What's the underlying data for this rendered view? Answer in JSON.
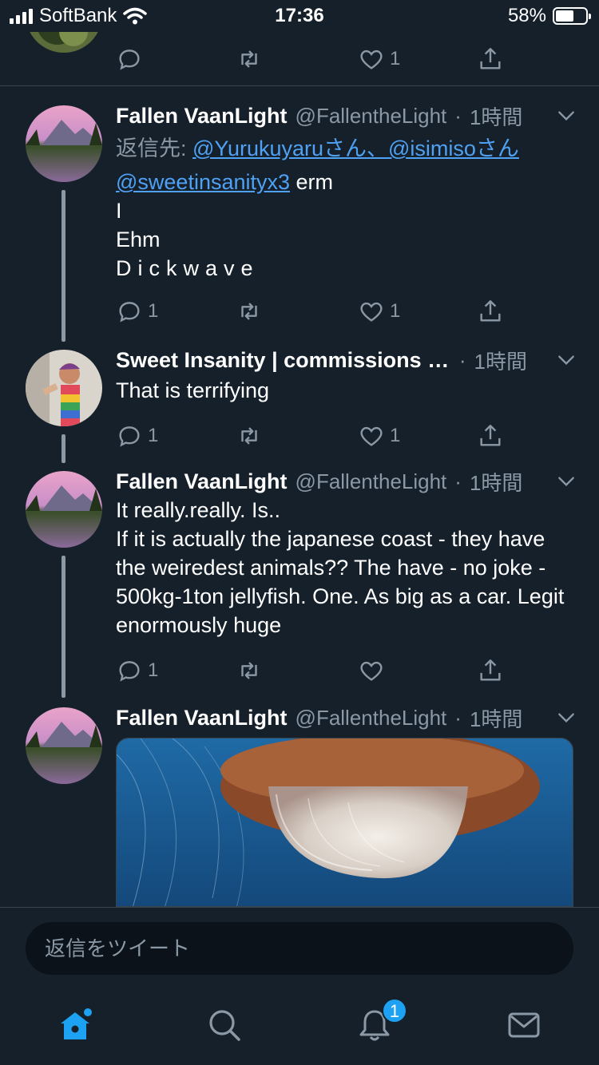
{
  "status_bar": {
    "carrier": "SoftBank",
    "time": "17:36",
    "battery": "58%"
  },
  "top_partial_tweet": {
    "like_count": "1"
  },
  "tweets": [
    {
      "name": "Fallen VaanLight",
      "handle": "@FallentheLight",
      "time_sep": "·",
      "time_ago": "1時間",
      "reply_prefix": "返信先: ",
      "reply_to_1": "@Yurukuyaruさん",
      "reply_sep": "、",
      "reply_to_2": "@isimisoさん",
      "mention": "@sweetinsanityx3",
      "text_1": " erm",
      "text_2": "I",
      "text_3": "Ehm",
      "text_4": "Dickwave",
      "reply_count": "1",
      "retweet_count": "",
      "like_count": "1"
    },
    {
      "name": "Sweet Insanity | commissions O...",
      "handle": "",
      "time_sep": "·",
      "time_ago": "1時間",
      "text": "That is terrifying",
      "reply_count": "1",
      "retweet_count": "",
      "like_count": "1"
    },
    {
      "name": "Fallen VaanLight",
      "handle": "@FallentheLight",
      "time_sep": "·",
      "time_ago": "1時間",
      "text": "It really.really. Is..\nIf it is actually the japanese coast - they have the weiredest animals?? The have - no joke - 500kg-1ton jellyfish. One. As big as a car. Legit enormously huge",
      "reply_count": "1",
      "retweet_count": "",
      "like_count": ""
    },
    {
      "name": "Fallen VaanLight",
      "handle": "@FallentheLight",
      "time_sep": "·",
      "time_ago": "1時間"
    }
  ],
  "reply_bar": {
    "placeholder": "返信をツイート"
  },
  "tab_bar": {
    "notifications_badge": "1",
    "icons": [
      "home-icon",
      "search-icon",
      "notifications-icon",
      "messages-icon"
    ]
  },
  "colors": {
    "background": "#15202b",
    "accent": "#1da1f2",
    "link": "#4ea1f3",
    "secondary_text": "#8b98a5"
  }
}
